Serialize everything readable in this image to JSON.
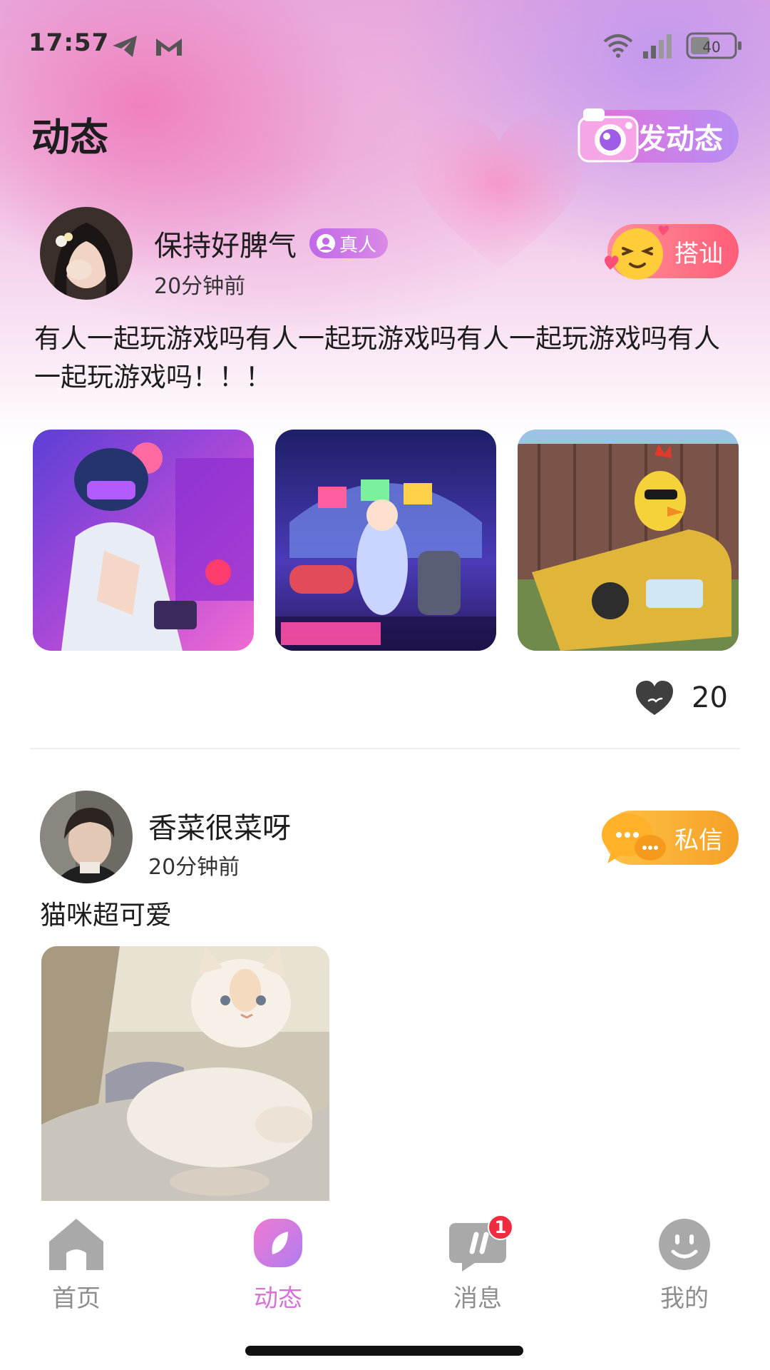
{
  "status_bar": {
    "time": "17:57",
    "battery": "40"
  },
  "header": {
    "title": "动态",
    "post_button": "发动态"
  },
  "posts": [
    {
      "username": "保持好脾气",
      "badge": "真人",
      "time": "20分钟前",
      "text": "有人一起玩游戏吗有人一起玩游戏吗有人一起玩游戏吗有人一起玩游戏吗！！！",
      "action": "搭讪",
      "likes": "20"
    },
    {
      "username": "香菜很菜呀",
      "time": "20分钟前",
      "text": "猫咪超可爱",
      "action": "私信"
    }
  ],
  "tabs": [
    {
      "label": "首页",
      "icon": "home-icon"
    },
    {
      "label": "动态",
      "icon": "moments-icon",
      "active": true
    },
    {
      "label": "消息",
      "icon": "message-icon",
      "badge": "1"
    },
    {
      "label": "我的",
      "icon": "profile-icon"
    }
  ],
  "colors": {
    "accent_pink": "#d872d8",
    "flirt_red": "#ff5e78",
    "dm_orange": "#f5a027",
    "badge_red": "#ee2b3f"
  }
}
